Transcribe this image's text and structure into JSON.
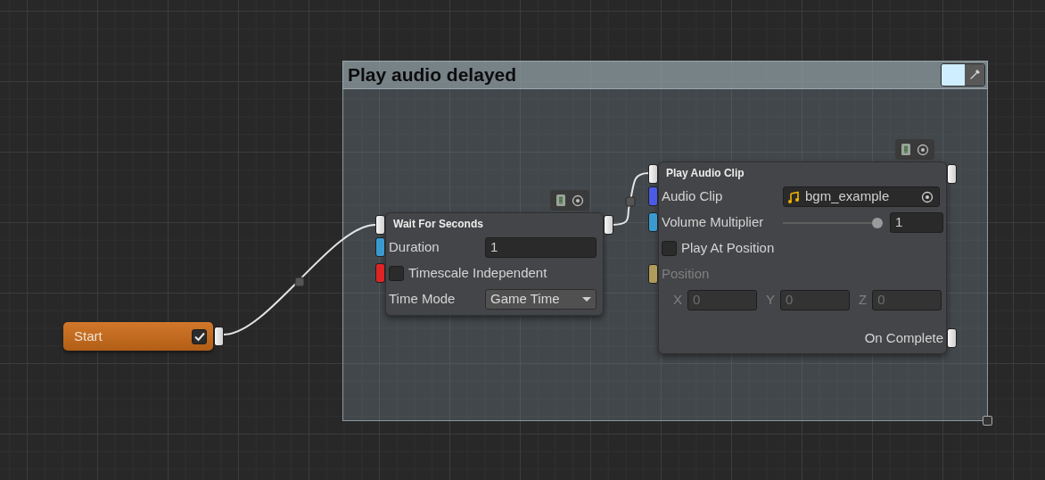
{
  "group": {
    "title": "Play audio delayed",
    "color": "#cfeeff"
  },
  "start_node": {
    "title": "Start",
    "checked": true
  },
  "nodes": [
    {
      "title": "Wait For Seconds",
      "rows": [
        {
          "kind": "number",
          "label": "Duration",
          "value": "1",
          "color": "#3a9ad0"
        },
        {
          "kind": "toggle",
          "label": "Timescale Independent",
          "checked": false,
          "color": "#e02424"
        },
        {
          "kind": "dropdown",
          "label": "Time Mode",
          "value": "Game Time"
        }
      ]
    },
    {
      "title": "Play Audio Clip",
      "rows": [
        {
          "kind": "object",
          "label": "Audio Clip",
          "value": "bgm_example",
          "color": "#4b5be6"
        },
        {
          "kind": "slider",
          "label": "Volume Multiplier",
          "level": 1,
          "value": "1",
          "color": "#3a9ad0"
        },
        {
          "kind": "toggle",
          "label": "Play At Position",
          "checked": false
        },
        {
          "kind": "header",
          "label": "Position",
          "disabled": true,
          "color": "#b09a5c"
        },
        {
          "kind": "vector",
          "disabled": true,
          "components": [
            {
              "axis": "X",
              "value": "0"
            },
            {
              "axis": "Y",
              "value": "0"
            },
            {
              "axis": "Z",
              "value": "0"
            }
          ]
        },
        {
          "kind": "output",
          "label": "On Complete"
        }
      ]
    }
  ]
}
